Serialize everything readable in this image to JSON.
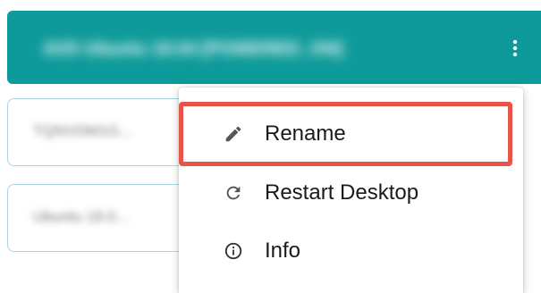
{
  "header": {
    "title": "AVD Ubuntu 18.04 [POWERED_ON]",
    "more_icon": "kebab-vertical-icon",
    "color": "#0e9a9a"
  },
  "cards": [
    {
      "label": "TQNVDM1G..."
    },
    {
      "label": "Ubuntu 18.0..."
    }
  ],
  "menu": {
    "items": [
      {
        "label": "Rename",
        "icon": "pencil-icon"
      },
      {
        "label": "Restart Desktop",
        "icon": "restart-icon"
      },
      {
        "label": "Info",
        "icon": "info-icon"
      }
    ],
    "highlighted": "Rename",
    "highlight_color": "#e8534a"
  }
}
